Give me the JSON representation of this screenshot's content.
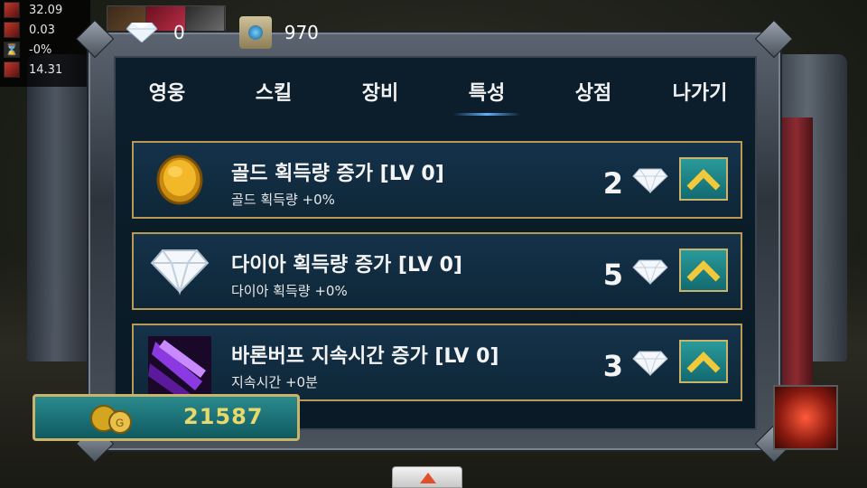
{
  "stats": [
    {
      "icon": "sword-icon",
      "value": "32.09"
    },
    {
      "icon": "attack-icon",
      "value": "0.03"
    },
    {
      "icon": "hourglass-icon",
      "value": "-0%"
    },
    {
      "icon": "arrow-icon",
      "value": "14.31"
    }
  ],
  "currency": {
    "diamonds": "0",
    "scrolls": "970"
  },
  "tabs": [
    {
      "label": "영웅",
      "active": false
    },
    {
      "label": "스킬",
      "active": false
    },
    {
      "label": "장비",
      "active": false
    },
    {
      "label": "특성",
      "active": true
    },
    {
      "label": "상점",
      "active": false
    },
    {
      "label": "나가기",
      "active": false
    }
  ],
  "traits": [
    {
      "icon": "gold-coin-icon",
      "title": "골드 획득량 증가 [LV 0]",
      "desc": "골드 획득량 +0%",
      "cost": "2"
    },
    {
      "icon": "diamond-icon",
      "title": "다이아 획득량 증가 [LV 0]",
      "desc": "다이아 획득량 +0%",
      "cost": "5"
    },
    {
      "icon": "buff-skill-icon",
      "title": "바론버프 지속시간 증가 [LV 0]",
      "desc": "지속시간 +0분",
      "cost": "3"
    }
  ],
  "gold": "21587",
  "colors": {
    "row_border": "#b89a54",
    "gold_text": "#e8d96a",
    "accent_teal": "#2a9a9a"
  }
}
